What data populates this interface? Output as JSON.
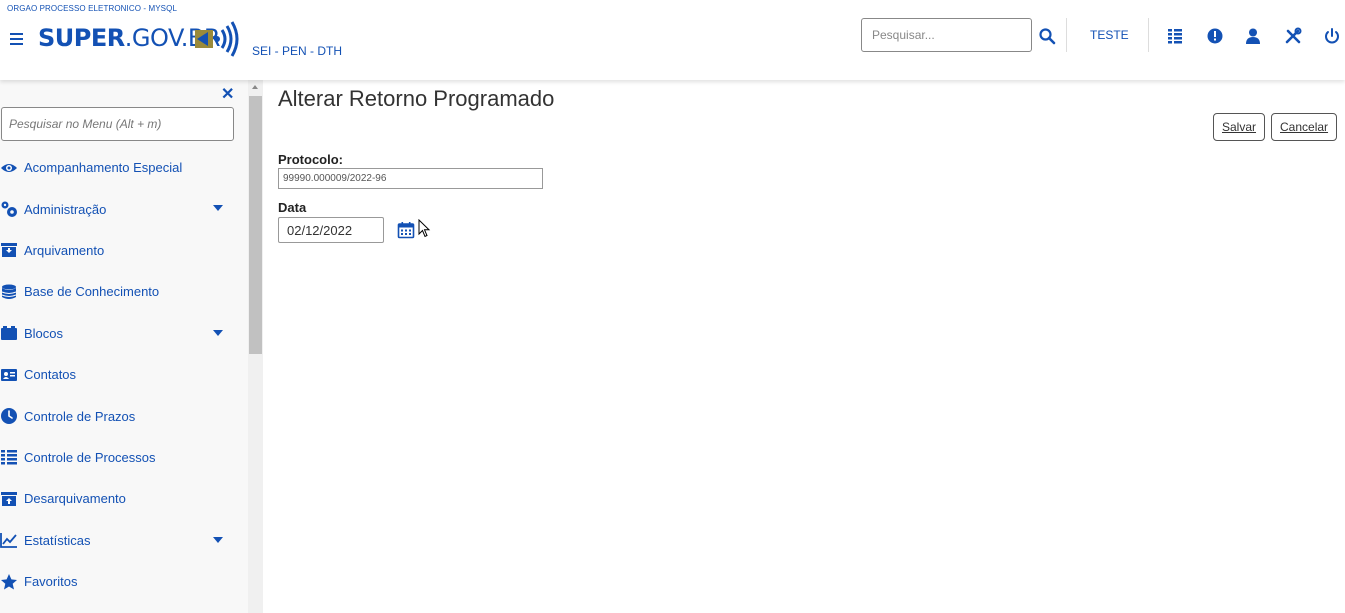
{
  "header": {
    "org_label": "ORGAO PROCESSO ELETRONICO - MYSQL",
    "logo_text_bold": "SUPER",
    "logo_text_thin": ".GOV.BR",
    "unit_label": "SEI - PEN - DTH",
    "search_placeholder": "Pesquisar...",
    "user_label": "TESTE"
  },
  "sidebar": {
    "search_placeholder": "Pesquisar no Menu (Alt + m)",
    "items": [
      {
        "label": "Acompanhamento Especial",
        "icon": "eye-icon",
        "has_submenu": false
      },
      {
        "label": "Administração",
        "icon": "gears-icon",
        "has_submenu": true
      },
      {
        "label": "Arquivamento",
        "icon": "archive-icon",
        "has_submenu": false
      },
      {
        "label": "Base de Conhecimento",
        "icon": "database-icon",
        "has_submenu": false
      },
      {
        "label": "Blocos",
        "icon": "folder-icon",
        "has_submenu": true
      },
      {
        "label": "Contatos",
        "icon": "contact-card-icon",
        "has_submenu": false
      },
      {
        "label": "Controle de Prazos",
        "icon": "clock-icon",
        "has_submenu": false
      },
      {
        "label": "Controle de Processos",
        "icon": "list-icon",
        "has_submenu": false
      },
      {
        "label": "Desarquivamento",
        "icon": "unarchive-icon",
        "has_submenu": false
      },
      {
        "label": "Estatísticas",
        "icon": "chart-line-icon",
        "has_submenu": true
      },
      {
        "label": "Favoritos",
        "icon": "star-icon",
        "has_submenu": false
      }
    ]
  },
  "main": {
    "title": "Alterar Retorno Programado",
    "save_label": "Salvar",
    "cancel_label": "Cancelar",
    "protocolo_label": "Protocolo:",
    "protocolo_value": "99990.000009/2022-96",
    "data_label": "Data",
    "data_value": "02/12/2022"
  },
  "colors": {
    "accent": "#1351b4",
    "sidebar_bg": "#f8f8f8"
  }
}
